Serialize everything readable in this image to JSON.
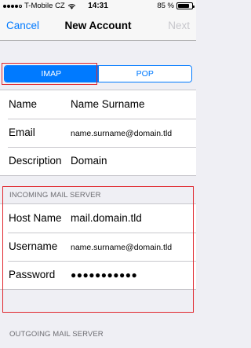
{
  "status_bar": {
    "signal_filled": 4,
    "signal_total": 5,
    "carrier": "T-Mobile CZ",
    "time": "14:31",
    "battery_percent": "85 %",
    "battery_level": 0.85
  },
  "nav": {
    "left": "Cancel",
    "title": "New Account",
    "right": "Next"
  },
  "account_type": {
    "options": [
      "IMAP",
      "POP"
    ],
    "selected": "IMAP"
  },
  "account": {
    "rows": [
      {
        "label": "Name",
        "value": "Name Surname"
      },
      {
        "label": "Email",
        "value": "name.surname@domain.tld"
      },
      {
        "label": "Description",
        "value": "Domain"
      }
    ]
  },
  "incoming": {
    "header": "INCOMING MAIL SERVER",
    "rows": [
      {
        "label": "Host Name",
        "value": "mail.domain.tld"
      },
      {
        "label": "Username",
        "value": "name.surname@domain.tld"
      },
      {
        "label": "Password",
        "value": "●●●●●●●●●●●"
      }
    ]
  },
  "outgoing": {
    "header": "OUTGOING MAIL SERVER"
  },
  "colors": {
    "accent": "#007aff",
    "highlight": "#e0262d",
    "background": "#efeff4",
    "disabled": "#c7c7cc"
  }
}
